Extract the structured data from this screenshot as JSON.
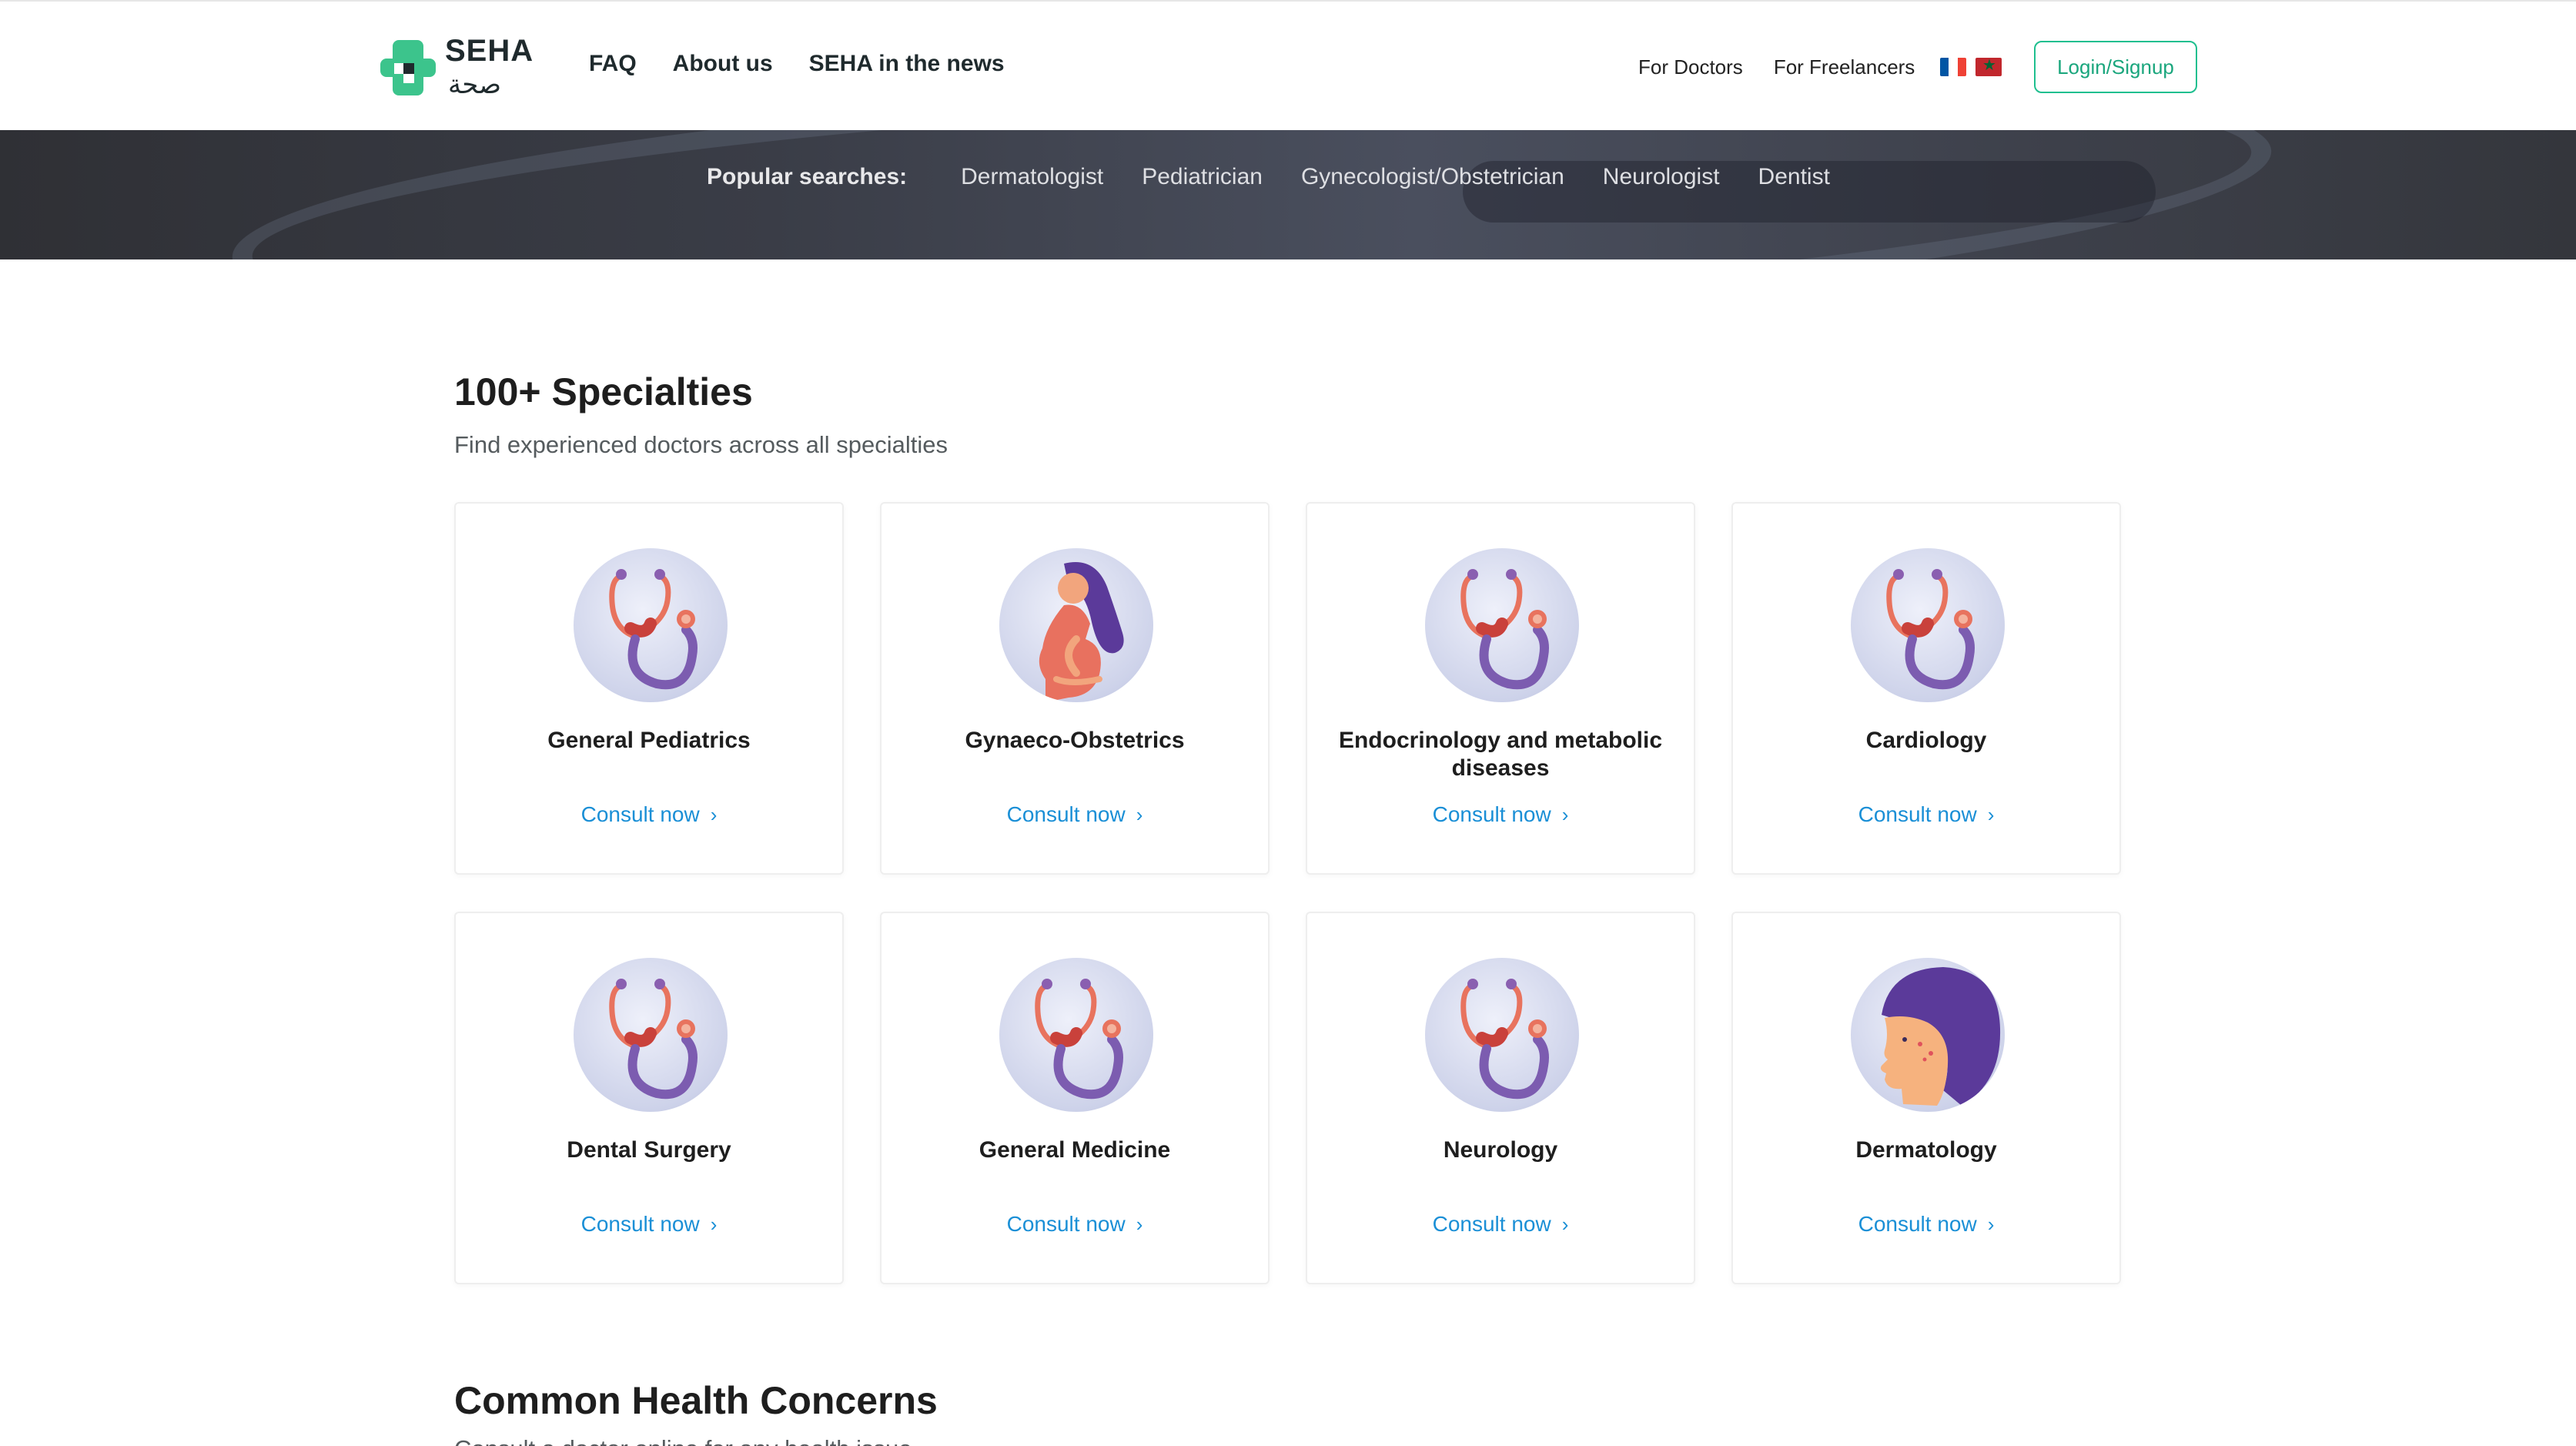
{
  "brand": {
    "name": "SEHA",
    "arabic": "صحة"
  },
  "nav_left": [
    "FAQ",
    "About us",
    "SEHA in the news"
  ],
  "nav_right": [
    "For Doctors",
    "For Freelancers"
  ],
  "login_label": "Login/Signup",
  "popular": {
    "title": "Popular searches:",
    "items": [
      "Dermatologist",
      "Pediatrician",
      "Gynecologist/Obstetrician",
      "Neurologist",
      "Dentist"
    ]
  },
  "specialties": {
    "title": "100+ Specialties",
    "subtitle": "Find experienced doctors across all specialties",
    "cards": [
      {
        "name": "General Pediatrics",
        "cta": "Consult now",
        "icon": "stethoscope-icon"
      },
      {
        "name": "Gynaeco-Obstetrics",
        "cta": "Consult now",
        "icon": "pregnant-woman-icon"
      },
      {
        "name": "Endocrinology and metabolic diseases",
        "cta": "Consult now",
        "icon": "stethoscope-icon"
      },
      {
        "name": "Cardiology",
        "cta": "Consult now",
        "icon": "stethoscope-icon"
      },
      {
        "name": "Dental Surgery",
        "cta": "Consult now",
        "icon": "stethoscope-icon"
      },
      {
        "name": "General Medicine",
        "cta": "Consult now",
        "icon": "stethoscope-icon"
      },
      {
        "name": "Neurology",
        "cta": "Consult now",
        "icon": "stethoscope-icon"
      },
      {
        "name": "Dermatology",
        "cta": "Consult now",
        "icon": "face-skin-icon"
      }
    ]
  },
  "common": {
    "title": "Common Health Concerns",
    "subtitle": "Consult a doctor online for any health issue"
  },
  "colors": {
    "accent_green": "#1fbf8f",
    "link_blue": "#1a8fd6",
    "dark_text": "#1e1e1e"
  }
}
